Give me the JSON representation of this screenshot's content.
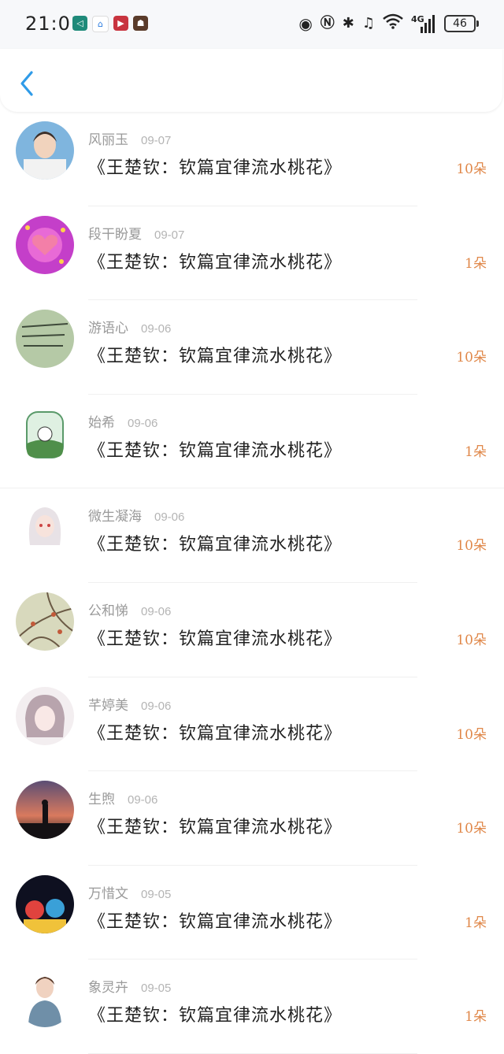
{
  "status_bar": {
    "time": "21:01",
    "battery": "46",
    "network": "4G"
  },
  "colors": {
    "accent_blue": "#2f9be8",
    "count_orange": "#e0884a"
  },
  "header": {
    "back_icon": "chevron-left-icon"
  },
  "items": [
    {
      "name": "风丽玉",
      "date": "09-07",
      "title": "《王楚钦：钦篇宜律流水桃花》",
      "count": "10朵"
    },
    {
      "name": "段干盼夏",
      "date": "09-07",
      "title": "《王楚钦：钦篇宜律流水桃花》",
      "count": "1朵"
    },
    {
      "name": "游语心",
      "date": "09-06",
      "title": "《王楚钦：钦篇宜律流水桃花》",
      "count": "10朵"
    },
    {
      "name": "始希",
      "date": "09-06",
      "title": "《王楚钦：钦篇宜律流水桃花》",
      "count": "1朵"
    },
    {
      "name": "微生凝海",
      "date": "09-06",
      "title": "《王楚钦：钦篇宜律流水桃花》",
      "count": "10朵"
    },
    {
      "name": "公和悌",
      "date": "09-06",
      "title": "《王楚钦：钦篇宜律流水桃花》",
      "count": "10朵"
    },
    {
      "name": "芊婷美",
      "date": "09-06",
      "title": "《王楚钦：钦篇宜律流水桃花》",
      "count": "10朵"
    },
    {
      "name": "生煦",
      "date": "09-06",
      "title": "《王楚钦：钦篇宜律流水桃花》",
      "count": "10朵"
    },
    {
      "name": "万惜文",
      "date": "09-05",
      "title": "《王楚钦：钦篇宜律流水桃花》",
      "count": "1朵"
    },
    {
      "name": "象灵卉",
      "date": "09-05",
      "title": "《王楚钦：钦篇宜律流水桃花》",
      "count": "1朵"
    }
  ]
}
